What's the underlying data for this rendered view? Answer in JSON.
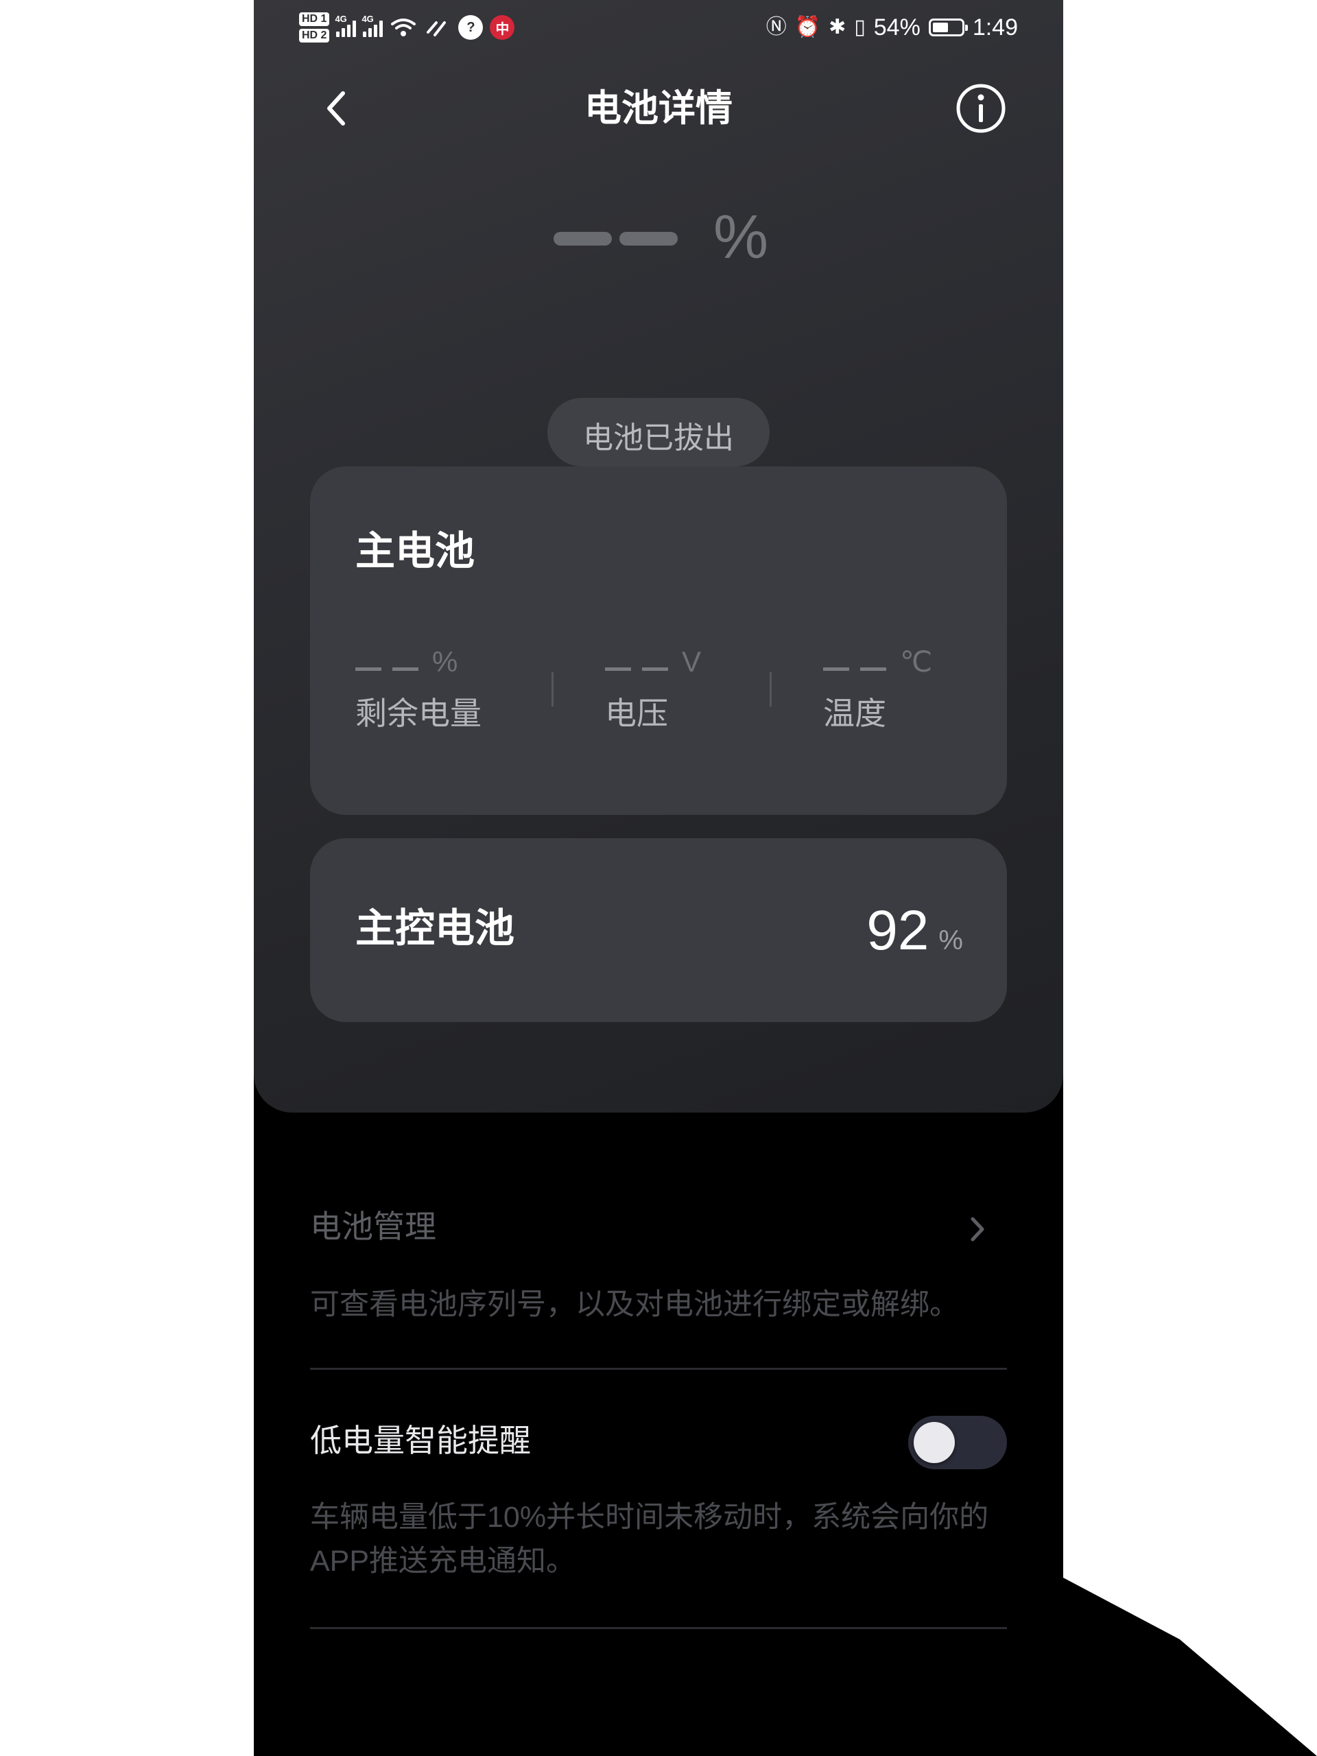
{
  "status_bar": {
    "sim1_label": "HD 1",
    "sim2_label": "HD 2",
    "net1": "4G",
    "net2": "4G",
    "app_icon_1": "?",
    "app_icon_2": "中",
    "icons": [
      "nfc-icon",
      "alarm-icon",
      "bluetooth-icon",
      "vibrate-icon"
    ],
    "battery_percent": "54%",
    "battery_level": 0.54,
    "time": "1:49"
  },
  "header": {
    "title": "电池详情",
    "back_icon": "chevron-left-icon",
    "info_icon": "info-circle-icon"
  },
  "summary": {
    "value_placeholder": "— —",
    "unit": "%"
  },
  "status_pill": {
    "text": "电池已拔出"
  },
  "main_battery": {
    "title": "主电池",
    "stats": [
      {
        "value": "— —",
        "unit": "%",
        "label": "剩余电量"
      },
      {
        "value": "— —",
        "unit": "V",
        "label": "电压"
      },
      {
        "value": "— —",
        "unit": "℃",
        "label": "温度"
      }
    ]
  },
  "control_battery": {
    "title": "主控电池",
    "value": "92",
    "unit": "%"
  },
  "battery_management": {
    "title": "电池管理",
    "description": "可查看电池序列号，以及对电池进行绑定或解绑。",
    "chevron_icon": "chevron-right-icon"
  },
  "low_battery_reminder": {
    "title": "低电量智能提醒",
    "enabled": false,
    "description": "车辆电量低于10%并长时间未移动时，系统会向你的APP推送充电通知。"
  },
  "colors": {
    "panel_bg": "#2d2e33",
    "card_bg": "#3b3c41",
    "page_bg": "#000000",
    "toggle_off_bg": "#2b2c39"
  }
}
